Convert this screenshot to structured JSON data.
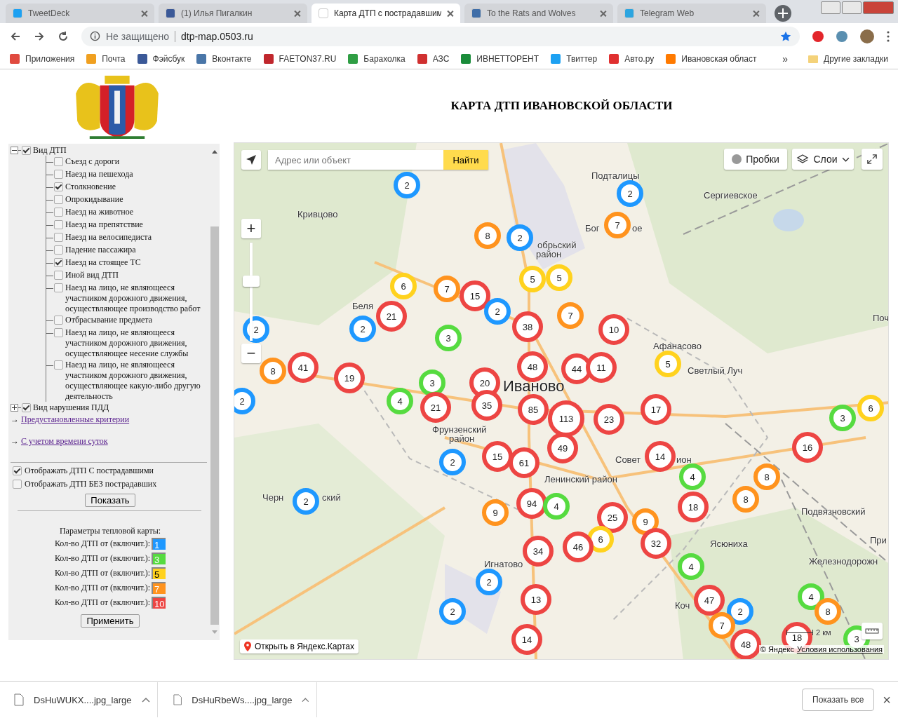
{
  "browser": {
    "tabs": [
      {
        "label": "TweetDeck",
        "selected": false
      },
      {
        "label": "(1) Илья Пигалкин",
        "selected": false
      },
      {
        "label": "Карта ДТП с пострадавшим",
        "selected": true
      },
      {
        "label": "To the Rats and Wolves",
        "selected": false
      },
      {
        "label": "Telegram Web",
        "selected": false
      }
    ],
    "security": "Не защищено",
    "url": "dtp-map.0503.ru",
    "bookmarks": [
      "Приложения",
      "Почта",
      "Фэйсбук",
      "Вконтакте",
      "FAETON37.RU",
      "Барахолка",
      "АЗС",
      "ИВНЕТТОРЕНТ",
      "Твиттер",
      "Авто.ру",
      "Ивановская област"
    ],
    "more": "»",
    "other_bookmarks": "Другие закладки"
  },
  "page": {
    "title": "КАРТА ДТП ИВАНОВСКОЙ ОБЛАСТИ"
  },
  "filters": {
    "tree": [
      {
        "label": "Вид ДТП",
        "checked": true,
        "expanded": true,
        "children": [
          {
            "label": "Съезд с дороги",
            "checked": false
          },
          {
            "label": "Наезд на пешехода",
            "checked": false
          },
          {
            "label": "Столкновение",
            "checked": true
          },
          {
            "label": "Опрокидывание",
            "checked": false
          },
          {
            "label": "Наезд на животное",
            "checked": false
          },
          {
            "label": "Наезд на препятствие",
            "checked": false
          },
          {
            "label": "Наезд на велосипедиста",
            "checked": false
          },
          {
            "label": "Падение пассажира",
            "checked": false
          },
          {
            "label": "Наезд на стоящее ТС",
            "checked": true
          },
          {
            "label": "Иной вид ДТП",
            "checked": false
          },
          {
            "label": "Наезд на лицо, не являющееся участником дорожного движения, осуществляющее производство работ",
            "checked": false
          },
          {
            "label": "Отбрасывание предмета",
            "checked": false
          },
          {
            "label": "Наезд на лицо, не являющееся участником дорожного движения, осуществляющее несение службы",
            "checked": false
          },
          {
            "label": "Наезд на лицо, не являющееся участником дорожного движения, осуществляющее какую-либо другую деятельность",
            "checked": false
          }
        ]
      },
      {
        "label": "Вид нарушения ПДД",
        "checked": true,
        "expanded": false
      }
    ],
    "links": [
      {
        "arrow": "→",
        "label": "Предустановленные критерии"
      },
      {
        "arrow": "→",
        "label": "С учетом времени суток"
      }
    ],
    "options": [
      {
        "label": "Отображать ДТП С пострадавшими",
        "checked": true
      },
      {
        "label": "Отображать ДТП БЕЗ пострадавших",
        "checked": false
      }
    ],
    "show_button": "Показать",
    "heat_title": "Параметры тепловой карты:",
    "heat_rows": [
      {
        "label": "Кол-во ДТП от (включит.):",
        "value": "1",
        "color": "#1e98ff"
      },
      {
        "label": "Кол-во ДТП от (включит.):",
        "value": "3",
        "color": "#56db40"
      },
      {
        "label": "Кол-во ДТП от (включит.):",
        "value": "5",
        "color": "#ffd21e"
      },
      {
        "label": "Кол-во ДТП от (включит.):",
        "value": "7",
        "color": "#ff931e"
      },
      {
        "label": "Кол-во ДТП от (включит.):",
        "value": "10",
        "color": "#ed4543"
      }
    ],
    "apply_button": "Применить"
  },
  "map": {
    "search_placeholder": "Адрес или объект",
    "search_button": "Найти",
    "traffic": "Пробки",
    "layers": "Слои",
    "zoom": {
      "plus": "+",
      "minus": "−",
      "level": 0.62
    },
    "open_link": "Открыть в Яндекс.Картах",
    "scale": "2 км",
    "copyright": "© Яндекс",
    "terms": "Условия использования",
    "labels": [
      {
        "text": "Подталицы",
        "kind": "village"
      },
      {
        "text": "Сергиевское",
        "kind": "village"
      },
      {
        "text": "Кривцово",
        "kind": "village"
      },
      {
        "text": "Бог",
        "kind": "village"
      },
      {
        "text": "ое",
        "kind": "village"
      },
      {
        "text": "обрьский",
        "kind": "village"
      },
      {
        "text": "район",
        "kind": "village"
      },
      {
        "text": "Беля",
        "kind": "village"
      },
      {
        "text": "Поч",
        "kind": "village"
      },
      {
        "text": "Афанасово",
        "kind": "village"
      },
      {
        "text": "Светлый Луч",
        "kind": "village"
      },
      {
        "text": "Иваново",
        "kind": "city"
      },
      {
        "text": "Фрунзенский",
        "kind": "village"
      },
      {
        "text": "район",
        "kind": "village"
      },
      {
        "text": "Совет",
        "kind": "village"
      },
      {
        "text": "ион",
        "kind": "village"
      },
      {
        "text": "Ленинский район",
        "kind": "village"
      },
      {
        "text": "Черн",
        "kind": "village"
      },
      {
        "text": "ский",
        "kind": "village"
      },
      {
        "text": "Подвязновский",
        "kind": "village"
      },
      {
        "text": "При",
        "kind": "village"
      },
      {
        "text": "Ясюниха",
        "kind": "village"
      },
      {
        "text": "Игнатово",
        "kind": "village"
      },
      {
        "text": "Железнодорожн",
        "kind": "village"
      },
      {
        "text": "Коч",
        "kind": "village"
      }
    ],
    "clusters": [
      {
        "count": "2",
        "color": "#1e98ff"
      },
      {
        "count": "2",
        "color": "#1e98ff"
      },
      {
        "count": "8",
        "color": "#ff931e"
      },
      {
        "count": "2",
        "color": "#1e98ff"
      },
      {
        "count": "7",
        "color": "#ff931e"
      },
      {
        "count": "6",
        "color": "#ffd21e"
      },
      {
        "count": "7",
        "color": "#ff931e"
      },
      {
        "count": "15",
        "color": "#ed4543"
      },
      {
        "count": "5",
        "color": "#ffd21e"
      },
      {
        "count": "5",
        "color": "#ffd21e"
      },
      {
        "count": "2",
        "color": "#1e98ff"
      },
      {
        "count": "21",
        "color": "#ed4543"
      },
      {
        "count": "2",
        "color": "#1e98ff"
      },
      {
        "count": "2",
        "color": "#1e98ff"
      },
      {
        "count": "7",
        "color": "#ff931e"
      },
      {
        "count": "38",
        "color": "#ed4543"
      },
      {
        "count": "10",
        "color": "#ed4543"
      },
      {
        "count": "3",
        "color": "#56db40"
      },
      {
        "count": "5",
        "color": "#ffd21e"
      },
      {
        "count": "8",
        "color": "#ff931e"
      },
      {
        "count": "41",
        "color": "#ed4543"
      },
      {
        "count": "19",
        "color": "#ed4543"
      },
      {
        "count": "48",
        "color": "#ed4543"
      },
      {
        "count": "44",
        "color": "#ed4543"
      },
      {
        "count": "11",
        "color": "#ed4543"
      },
      {
        "count": "3",
        "color": "#56db40"
      },
      {
        "count": "20",
        "color": "#ed4543"
      },
      {
        "count": "2",
        "color": "#1e98ff"
      },
      {
        "count": "4",
        "color": "#56db40"
      },
      {
        "count": "21",
        "color": "#ed4543"
      },
      {
        "count": "35",
        "color": "#ed4543"
      },
      {
        "count": "85",
        "color": "#ed4543"
      },
      {
        "count": "113",
        "color": "#ed4543"
      },
      {
        "count": "23",
        "color": "#ed4543"
      },
      {
        "count": "17",
        "color": "#ed4543"
      },
      {
        "count": "6",
        "color": "#ffd21e"
      },
      {
        "count": "3",
        "color": "#56db40"
      },
      {
        "count": "16",
        "color": "#ed4543"
      },
      {
        "count": "2",
        "color": "#1e98ff"
      },
      {
        "count": "15",
        "color": "#ed4543"
      },
      {
        "count": "61",
        "color": "#ed4543"
      },
      {
        "count": "49",
        "color": "#ed4543"
      },
      {
        "count": "14",
        "color": "#ed4543"
      },
      {
        "count": "4",
        "color": "#56db40"
      },
      {
        "count": "8",
        "color": "#ff931e"
      },
      {
        "count": "2",
        "color": "#1e98ff"
      },
      {
        "count": "8",
        "color": "#ff931e"
      },
      {
        "count": "18",
        "color": "#ed4543"
      },
      {
        "count": "9",
        "color": "#ff931e"
      },
      {
        "count": "94",
        "color": "#ed4543"
      },
      {
        "count": "4",
        "color": "#56db40"
      },
      {
        "count": "25",
        "color": "#ed4543"
      },
      {
        "count": "9",
        "color": "#ff931e"
      },
      {
        "count": "6",
        "color": "#ffd21e"
      },
      {
        "count": "32",
        "color": "#ed4543"
      },
      {
        "count": "34",
        "color": "#ed4543"
      },
      {
        "count": "46",
        "color": "#ed4543"
      },
      {
        "count": "4",
        "color": "#56db40"
      },
      {
        "count": "2",
        "color": "#1e98ff"
      },
      {
        "count": "2",
        "color": "#1e98ff"
      },
      {
        "count": "13",
        "color": "#ed4543"
      },
      {
        "count": "47",
        "color": "#ed4543"
      },
      {
        "count": "2",
        "color": "#1e98ff"
      },
      {
        "count": "4",
        "color": "#56db40"
      },
      {
        "count": "8",
        "color": "#ff931e"
      },
      {
        "count": "7",
        "color": "#ff931e"
      },
      {
        "count": "14",
        "color": "#ed4543"
      },
      {
        "count": "18",
        "color": "#ed4543"
      },
      {
        "count": "3",
        "color": "#56db40"
      },
      {
        "count": "48",
        "color": "#ed4543"
      }
    ]
  },
  "downloads": {
    "files": [
      "DsHuWUKX....jpg_large",
      "DsHuRbeWs....jpg_large"
    ],
    "show_all": "Показать все",
    "close": "×"
  }
}
